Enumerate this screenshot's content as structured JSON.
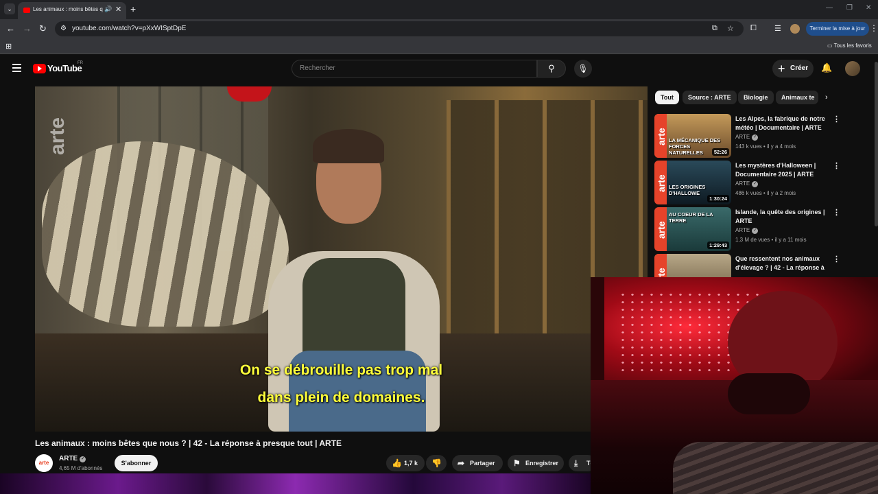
{
  "browser": {
    "tab_title": "Les animaux : moins bêtes q",
    "url": "youtube.com/watch?v=pXxWISptDpE",
    "update_label": "Terminer la mise à jour",
    "favorites_label": "Tous les favoris",
    "icons": [
      "tab-list-icon",
      "audio-icon",
      "close-icon",
      "new-tab-icon",
      "back-icon",
      "forward-icon",
      "reload-icon",
      "site-info-icon",
      "install-icon",
      "star-icon",
      "extensions-icon",
      "reading-list-icon",
      "profile-icon",
      "menu-icon",
      "apps-icon",
      "folder-icon"
    ]
  },
  "youtube": {
    "logo_text": "YouTube",
    "country": "FR",
    "search_placeholder": "Rechercher",
    "create_label": "Créer",
    "accent": "#ff0000"
  },
  "video": {
    "subtitle_line1": "On se débrouille pas trop mal",
    "subtitle_line2": "dans plein de domaines.",
    "watermark": "arte",
    "title": "Les animaux : moins bêtes que nous ? | 42 - La réponse à presque tout | ARTE",
    "channel": "ARTE",
    "channel_avatar": "arte",
    "subscribers": "4,65 M d'abonnés",
    "subscribe_label": "S'abonner",
    "likes": "1,7 k",
    "share_label": "Partager",
    "save_label": "Enregistrer",
    "download_label": "Té"
  },
  "chips": [
    "Tout",
    "Source : ARTE",
    "Biologie",
    "Animaux te"
  ],
  "recommendations": [
    {
      "title": "Les Alpes, la fabrique de notre météo | Documentaire | ARTE",
      "channel": "ARTE",
      "meta": "143 k vues • il y a 4 mois",
      "duration": "52:26",
      "thumb_text": "LA MÉCANIQUE DES FORCES NATURELLES",
      "thumb_color": "#8a6a3a"
    },
    {
      "title": "Les mystères d'Halloween | Documentaire 2025 | ARTE",
      "channel": "ARTE",
      "meta": "486 k vues • il y a 2 mois",
      "duration": "1:30:24",
      "thumb_text": "LES ORIGINES D'HALLOWE",
      "thumb_color": "#1e3a4a"
    },
    {
      "title": "Islande, la quête des origines | ARTE",
      "channel": "ARTE",
      "meta": "1,3 M de vues • il y a 11 mois",
      "duration": "1:29:43",
      "thumb_text": "AU COEUR DE LA TERRE",
      "thumb_color": "#2a5a6a"
    },
    {
      "title": "Que ressentent nos animaux d'élevage ? | 42 - La réponse à ...",
      "channel": "ARTE",
      "meta": "",
      "duration": "",
      "thumb_text": "",
      "thumb_color": "#a09070"
    }
  ]
}
